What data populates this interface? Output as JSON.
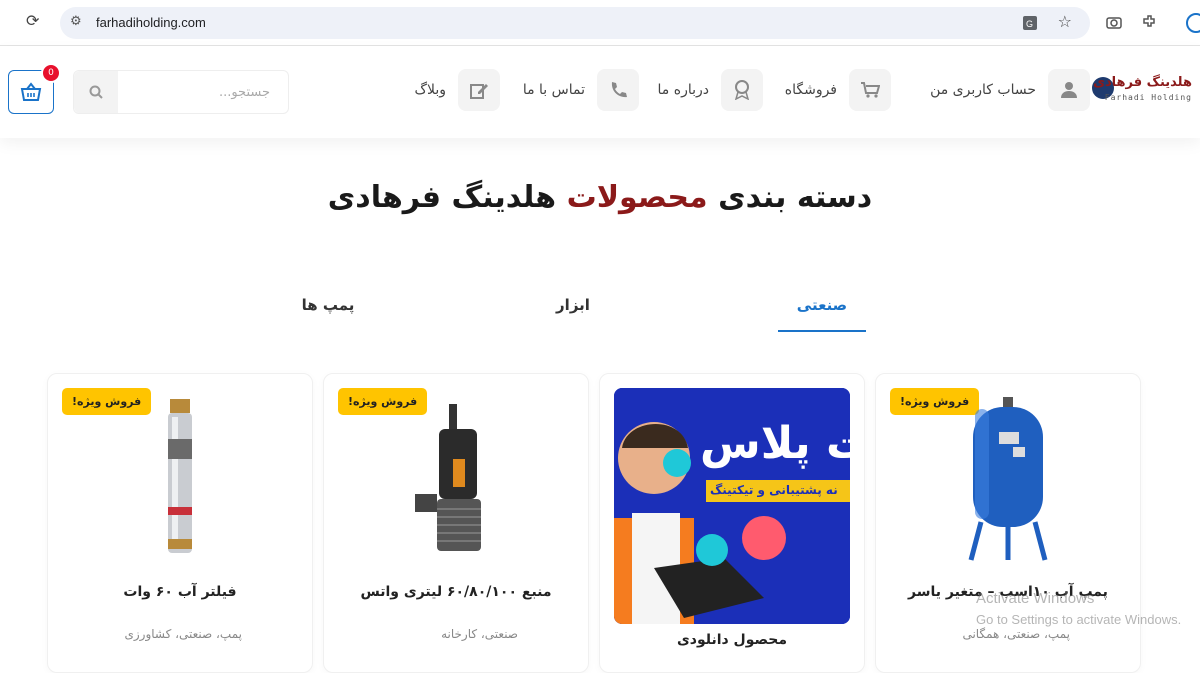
{
  "browser": {
    "url": "farhadiholding.com"
  },
  "header": {
    "logo_title": "هلدینگ فرهادی",
    "logo_sub": "Farhadi Holding",
    "menu": [
      {
        "label": "حساب کاربری من",
        "icon": "user-icon"
      },
      {
        "label": "فروشگاه",
        "icon": "cart-icon"
      },
      {
        "label": "درباره ما",
        "icon": "award-icon"
      },
      {
        "label": "تماس با ما",
        "icon": "phone-icon"
      },
      {
        "label": "وبلاگ",
        "icon": "edit-icon"
      }
    ],
    "search_placeholder": "جستجو...",
    "cart_count": "0"
  },
  "section": {
    "title_part1": "دسته بندی",
    "title_accent": "محصولات",
    "title_part2": "هلدینگ فرهادی"
  },
  "tabs": [
    {
      "label": "صنعتی",
      "active": true
    },
    {
      "label": "ابزار",
      "active": false
    },
    {
      "label": "پمپ ها",
      "active": false
    }
  ],
  "products": [
    {
      "title": "پمپ آب ۱۰اسب – متغیر یاسر",
      "categories": "پمپ، صنعتی، همگانی",
      "badge": "فروش ویژه!"
    },
    {
      "title": "محصول دانلودی",
      "categories": "",
      "badge": "",
      "promo_big": "ت پلاس",
      "promo_line": "نه پشتیبانی و تیکتینگ"
    },
    {
      "title": "منبع ۶۰/۸۰/۱۰۰ لیتری واتس",
      "categories": "صنعتی، کارخانه",
      "badge": "فروش ویژه!"
    },
    {
      "title": "فیلتر آب ۶۰ وات",
      "categories": "پمپ، صنعتی، کشاورزی",
      "badge": "فروش ویژه!"
    }
  ],
  "overlay": {
    "line1": "Activate Windows",
    "line2": "Go to Settings to activate Windows."
  }
}
